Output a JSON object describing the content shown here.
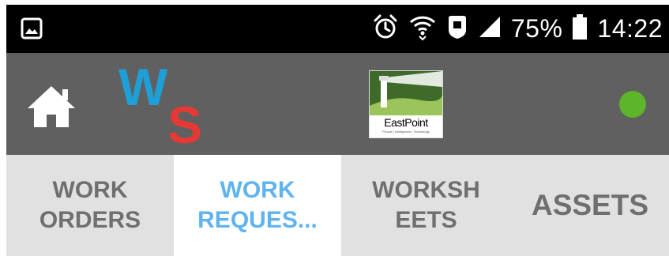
{
  "status_bar": {
    "battery_percent": "75%",
    "time": "14:22",
    "icons": [
      "gallery-icon",
      "alarm-clock-icon",
      "wifi-icon",
      "data-saver-icon",
      "signal-icon",
      "battery-icon"
    ]
  },
  "toolbar": {
    "left_icon": "home-icon",
    "app_logo_letters": [
      "W",
      "S"
    ],
    "company_logo_name": "EastPoint",
    "company_logo_tagline": "People | Intelligence | Technology",
    "status_indicator_color": "#5db52b"
  },
  "tabs": [
    {
      "label": "WORK\nORDERS",
      "active": false
    },
    {
      "label": "WORK\nREQUES...",
      "active": true
    },
    {
      "label": "WORKSH\nEETS",
      "active": false
    },
    {
      "label": "ASSETS",
      "active": false
    }
  ],
  "colors": {
    "status_bar_bg": "#000000",
    "toolbar_bg": "#606060",
    "tab_bg": "#e1e1e1",
    "tab_active_bg": "#ffffff",
    "tab_active_text": "#5fb4f0",
    "tab_text": "#6f6f6f"
  }
}
